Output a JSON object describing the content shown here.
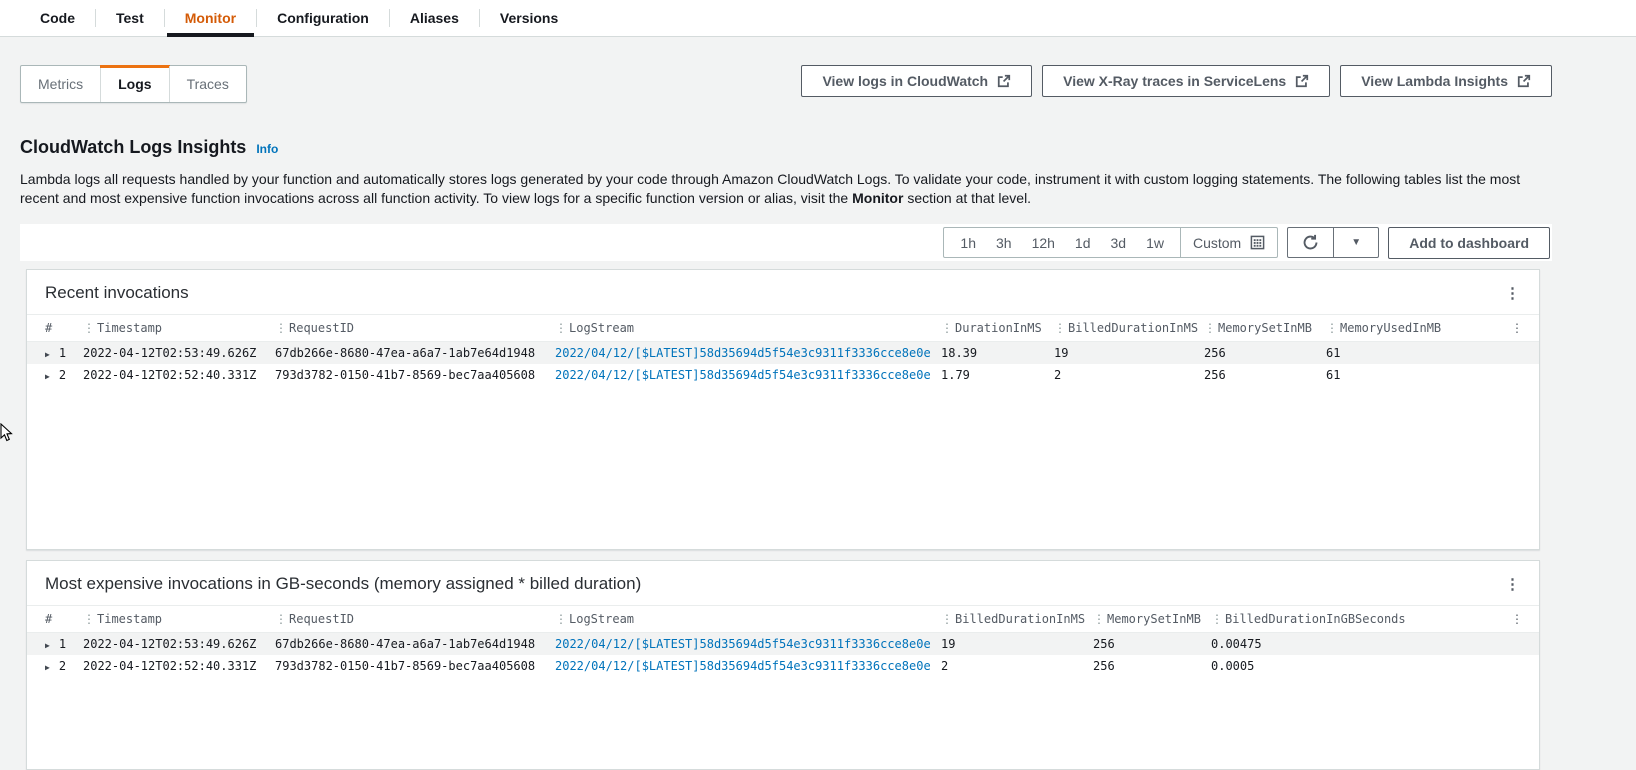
{
  "colors": {
    "accent_orange": "#ec7211",
    "active_tab_text": "#d45b07",
    "link_blue": "#0073bb",
    "page_background": "#f2f3f3",
    "stripe_row": "#f2f3f3"
  },
  "icons": {
    "kebab": "⋮",
    "column_menu": "⋮",
    "expander": "▶",
    "caret_down": "▼"
  },
  "tabs": {
    "active": "Monitor",
    "items": [
      "Code",
      "Test",
      "Monitor",
      "Configuration",
      "Aliases",
      "Versions"
    ]
  },
  "subtabs": {
    "active": "Logs",
    "items": [
      "Metrics",
      "Logs",
      "Traces"
    ]
  },
  "header_buttons": {
    "view_logs": "View logs in CloudWatch",
    "view_xray": "View X-Ray traces in ServiceLens",
    "view_insights": "View Lambda Insights"
  },
  "insights": {
    "title": "CloudWatch Logs Insights",
    "info_label": "Info",
    "description_part1": "Lambda logs all requests handled by your function and automatically stores logs generated by your code through Amazon CloudWatch Logs. To validate your code, instrument it with custom logging statements. The following tables list the most recent and most expensive function invocations across all function activity. To view logs for a specific function version or alias, visit the ",
    "description_bold": "Monitor",
    "description_part2": " section at that level."
  },
  "toolbar": {
    "ranges": [
      "1h",
      "3h",
      "12h",
      "1d",
      "3d",
      "1w"
    ],
    "custom_label": "Custom",
    "add_to_dashboard": "Add to dashboard"
  },
  "recent": {
    "title": "Recent invocations",
    "columns": [
      "#",
      "Timestamp",
      "RequestID",
      "LogStream",
      "DurationInMS",
      "BilledDurationInMS",
      "MemorySetInMB",
      "MemoryUsedInMB"
    ],
    "rows": [
      {
        "num": "1",
        "timestamp": "2022-04-12T02:53:49.626Z",
        "request_id": "67db266e-8680-47ea-a6a7-1ab7e64d1948",
        "log_stream": "2022/04/12/[$LATEST]58d35694d5f54e3c9311f3336cce8e0e",
        "duration_ms": "18.39",
        "billed_duration_ms": "19",
        "memory_set_mb": "256",
        "memory_used_mb": "61"
      },
      {
        "num": "2",
        "timestamp": "2022-04-12T02:52:40.331Z",
        "request_id": "793d3782-0150-41b7-8569-bec7aa405608",
        "log_stream": "2022/04/12/[$LATEST]58d35694d5f54e3c9311f3336cce8e0e",
        "duration_ms": "1.79",
        "billed_duration_ms": "2",
        "memory_set_mb": "256",
        "memory_used_mb": "61"
      }
    ]
  },
  "expensive": {
    "title": "Most expensive invocations in GB-seconds (memory assigned * billed duration)",
    "columns": [
      "#",
      "Timestamp",
      "RequestID",
      "LogStream",
      "BilledDurationInMS",
      "MemorySetInMB",
      "BilledDurationInGBSeconds"
    ],
    "rows": [
      {
        "num": "1",
        "timestamp": "2022-04-12T02:53:49.626Z",
        "request_id": "67db266e-8680-47ea-a6a7-1ab7e64d1948",
        "log_stream": "2022/04/12/[$LATEST]58d35694d5f54e3c9311f3336cce8e0e",
        "billed_duration_ms": "19",
        "memory_set_mb": "256",
        "billed_duration_gbs": "0.00475"
      },
      {
        "num": "2",
        "timestamp": "2022-04-12T02:52:40.331Z",
        "request_id": "793d3782-0150-41b7-8569-bec7aa405608",
        "log_stream": "2022/04/12/[$LATEST]58d35694d5f54e3c9311f3336cce8e0e",
        "billed_duration_ms": "2",
        "memory_set_mb": "256",
        "billed_duration_gbs": "0.0005"
      }
    ]
  }
}
